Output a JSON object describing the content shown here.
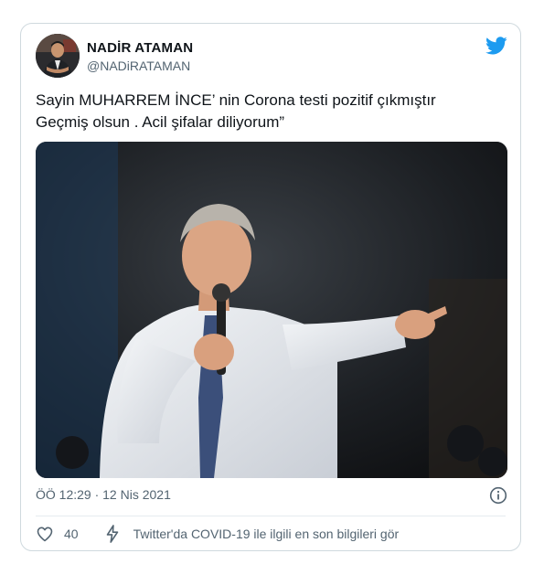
{
  "tweet": {
    "author_name": "NADİR ATAMAN",
    "handle": "@NADiRATAMAN",
    "text_line1": "Sayin MUHARREM İNCE’ nin Corona testi pozitif çıkmıştır",
    "text_line2": "Geçmiş olsun . Acil şifalar diliyorum”",
    "timestamp": "ÖÖ 12:29 · 12 Nis 2021",
    "like_count": "40",
    "covid_link": "Twitter'da COVID-19 ile ilgili en son bilgileri gör"
  },
  "icons": {
    "brand": "twitter-bird-icon",
    "info": "info-icon",
    "like": "heart-icon",
    "covid": "lightning-icon"
  },
  "colors": {
    "brand": "#1d9bf0",
    "text": "#0f1419",
    "secondary": "#536471",
    "border": "#cfd9de"
  }
}
